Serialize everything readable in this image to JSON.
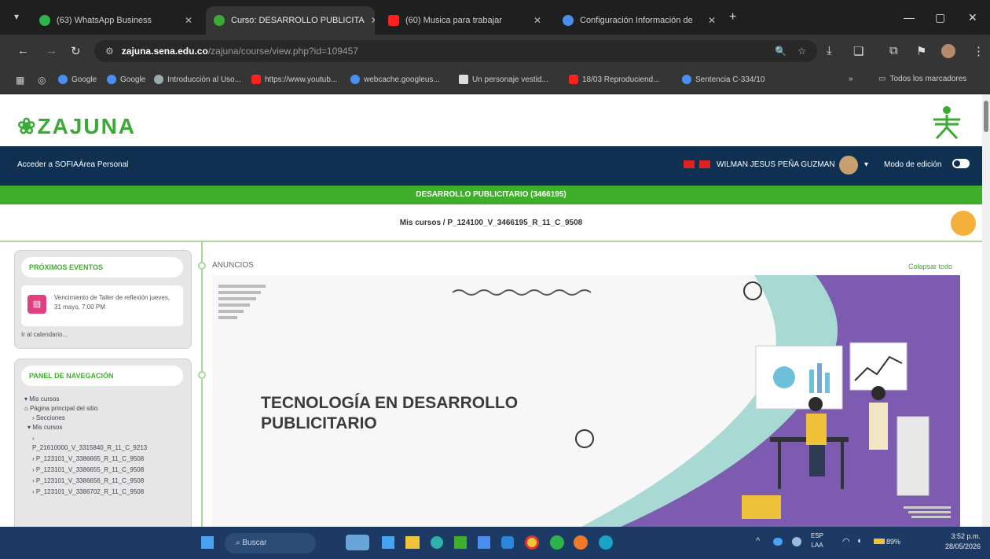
{
  "browser": {
    "tabs": [
      {
        "title": "(63) WhatsApp Business",
        "color": "#2ab44a",
        "active": false
      },
      {
        "title": "Curso: DESARROLLO PUBLICITA",
        "color": "#3aaa35",
        "active": true
      },
      {
        "title": "(60) Musica para trabajar",
        "color": "#ff2020",
        "active": false
      },
      {
        "title": "Configuración Información de",
        "color": "#4a8ef0",
        "active": false
      }
    ],
    "address": {
      "host": "zajuna.sena.edu.co",
      "path": "/zajuna/course/view.php?id=109457"
    },
    "bookmarks": [
      {
        "label": "Google",
        "color": "#4a8ef0"
      },
      {
        "label": "Google",
        "color": "#4a8ef0"
      },
      {
        "label": "Introducción al Uso...",
        "color": "#9aa"
      },
      {
        "label": "https://www.youtub...",
        "color": "#ff2020"
      },
      {
        "label": "webcache.googleus...",
        "color": "#4a8ef0"
      },
      {
        "label": "Un personaje vestid...",
        "color": "#ddd"
      },
      {
        "label": "18/03 Reproduciend...",
        "color": "#ff2020"
      },
      {
        "label": "Sentencia C-334/10",
        "color": "#4a8ef0"
      }
    ],
    "all_bookmarks": "Todos los marcadores"
  },
  "header": {
    "logo": "ZAJUNA",
    "nav_links": [
      "Acceder a SOFIA",
      "Área Personal"
    ],
    "user_name": "WILMAN JESUS PEÑA GUZMAN",
    "edit_mode": "Modo de edición"
  },
  "course": {
    "title": "DESARROLLO PUBLICITARIO (3466195)",
    "breadcrumb": "Mis cursos / P_124100_V_3466195_R_11_C_9508"
  },
  "sidebar": {
    "events_title": "PRÓXIMOS EVENTOS",
    "event_text": "Vencimiento de Taller de reflexión jueves, 31 mayo, 7:00 PM",
    "calendar_link": "Ir al calendario...",
    "nav_title": "PANEL DE NAVEGACIÓN",
    "nav_items": [
      "▾ Mis cursos",
      "Página principal del sitio",
      "› Secciones",
      "▾ Mis cursos",
      "›",
      "P_21610000_V_3315840_R_11_C_9213",
      "› P_123101_V_3386665_R_11_C_9508",
      "› P_123101_V_3386655_R_11_C_9508",
      "› P_123101_V_3386656_R_11_C_9508",
      "› P_123101_V_3386702_R_11_C_9508"
    ]
  },
  "main": {
    "section_label": "ANUNCIOS",
    "collapse_all": "Colapsar todo",
    "banner_title": "TECNOLOGÍA EN DESARROLLO PUBLICITARIO"
  },
  "taskbar": {
    "search_placeholder": "Buscar",
    "lang": "ESP",
    "lang2": "LAA",
    "battery": "89%",
    "time": "3:52 p.m.",
    "date": "28/05/2026"
  }
}
